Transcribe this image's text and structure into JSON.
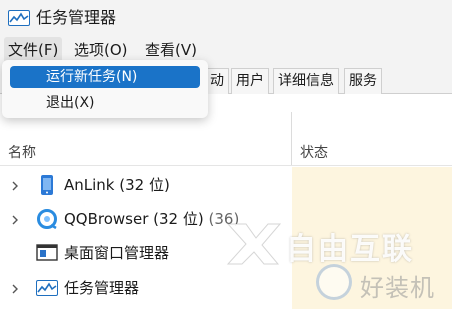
{
  "window": {
    "title": "任务管理器",
    "app_icon": "task-manager-icon"
  },
  "menubar": {
    "items": [
      {
        "label": "文件(F)"
      },
      {
        "label": "选项(O)"
      },
      {
        "label": "查看(V)"
      }
    ]
  },
  "file_menu": {
    "items": [
      {
        "label": "运行新任务(N)"
      },
      {
        "label": "退出(X)"
      }
    ]
  },
  "tabs": [
    {
      "label": "动"
    },
    {
      "label": "用户"
    },
    {
      "label": "详细信息"
    },
    {
      "label": "服务"
    }
  ],
  "table": {
    "columns": {
      "name": "名称",
      "status": "状态"
    },
    "rows": [
      {
        "name": "AnLink (32 位)",
        "extra": "",
        "icon": "anlink-icon",
        "expandable": true
      },
      {
        "name": "QQBrowser (32 位)",
        "extra": " (36)",
        "icon": "qqbrowser-icon",
        "expandable": true
      },
      {
        "name": "桌面窗口管理器",
        "extra": "",
        "icon": "desktop-window-manager-icon",
        "expandable": false
      },
      {
        "name": "任务管理器",
        "extra": "",
        "icon": "task-manager-icon",
        "expandable": true
      }
    ]
  },
  "watermark": {
    "text": "自由互联",
    "text2": "好装机"
  },
  "colors": {
    "highlight": "#1a73c8",
    "status_shade": "#fdf5df"
  }
}
